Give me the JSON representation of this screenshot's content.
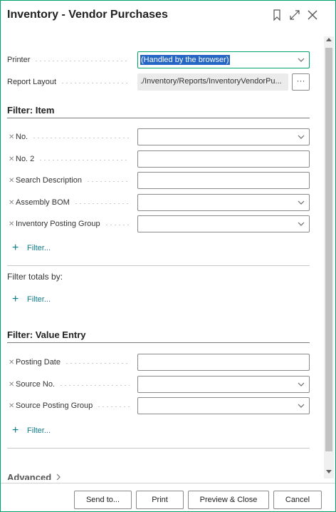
{
  "dialog": {
    "title": "Inventory - Vendor Purchases"
  },
  "options": {
    "printer_label": "Printer",
    "printer_value": "(Handled by the browser)",
    "report_layout_label": "Report Layout",
    "report_layout_value": "./Inventory/Reports/InventoryVendorPu...",
    "report_layout_button": "···"
  },
  "filter_item": {
    "heading": "Filter: Item",
    "fields": [
      {
        "label": "No.",
        "type": "dropdown",
        "value": ""
      },
      {
        "label": "No. 2",
        "type": "text",
        "value": ""
      },
      {
        "label": "Search Description",
        "type": "text",
        "value": ""
      },
      {
        "label": "Assembly BOM",
        "type": "dropdown",
        "value": ""
      },
      {
        "label": "Inventory Posting Group",
        "type": "dropdown",
        "value": ""
      }
    ],
    "add_filter": "Filter..."
  },
  "filter_totals": {
    "label": "Filter totals by:",
    "add_filter": "Filter..."
  },
  "filter_value_entry": {
    "heading": "Filter: Value Entry",
    "fields": [
      {
        "label": "Posting Date",
        "type": "text",
        "value": ""
      },
      {
        "label": "Source No.",
        "type": "dropdown",
        "value": ""
      },
      {
        "label": "Source Posting Group",
        "type": "dropdown",
        "value": ""
      }
    ],
    "add_filter": "Filter..."
  },
  "advanced": {
    "label": "Advanced"
  },
  "footer": {
    "send_to": "Send to...",
    "print": "Print",
    "preview_close": "Preview & Close",
    "cancel": "Cancel"
  },
  "icons": {
    "bookmark": "bookmark-icon",
    "expand": "expand-icon",
    "close": "close-icon",
    "dropdown": "chevron-down-icon",
    "remove": "remove-filter-icon",
    "add": "plus-icon",
    "advanced_chevron": "chevron-right-icon"
  },
  "colors": {
    "accent": "#00a36c",
    "link": "#0f7a8a",
    "selection": "#2566c4"
  }
}
